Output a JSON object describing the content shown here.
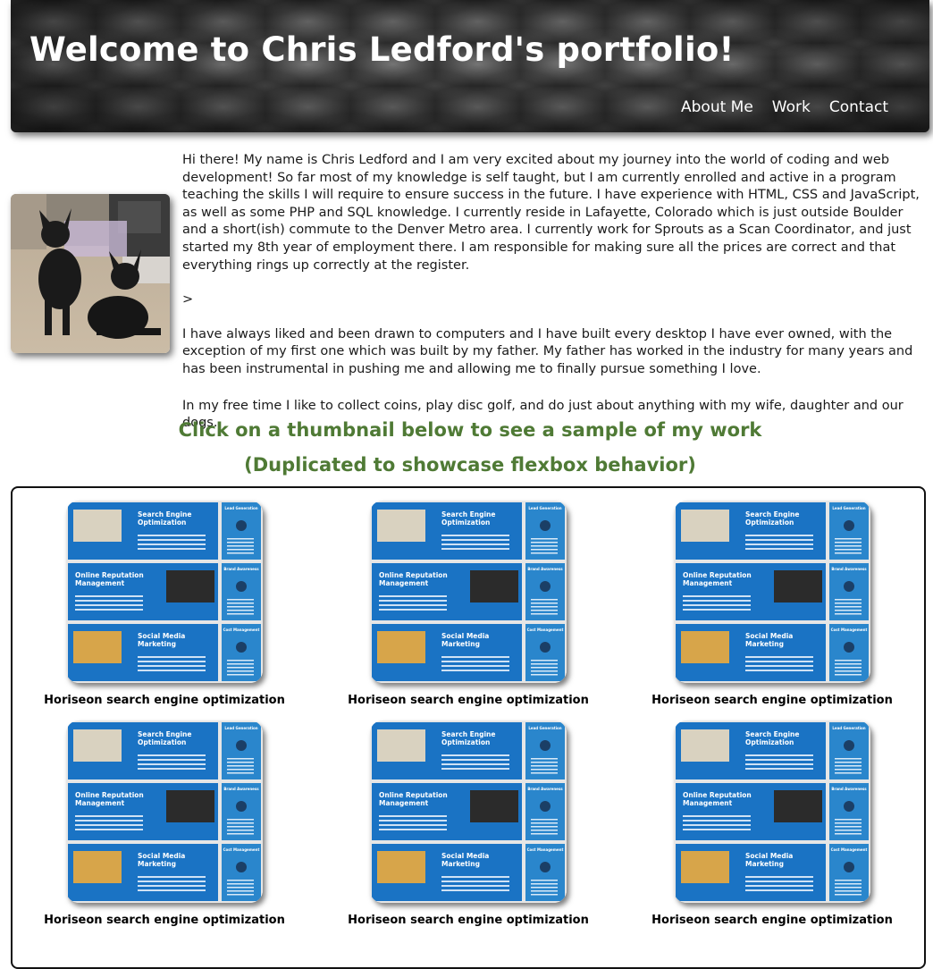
{
  "header": {
    "title": "Welcome to Chris Ledford's portfolio!",
    "nav": [
      "About Me",
      "Work",
      "Contact"
    ]
  },
  "about": {
    "paragraphs": [
      "Hi there! My name is Chris Ledford and I am very excited about my journey into the world of coding and web development! So far most of my knowledge is self taught, but I am currently enrolled and active in a program teaching the skills I will require to ensure success in the future. I have experience with HTML, CSS and JavaScript, as well as some PHP and SQL knowledge. I currently reside in Lafayette, Colorado which is just outside Boulder and a short(ish) commute to the Denver Metro area. I currently work for Sprouts as a Scan Coordinator, and just started my 8th year of employment there. I am responsible for making sure all the prices are correct and that everything rings up correctly at the register.",
      ">",
      "I have always liked and been drawn to computers and I have built every desktop I have ever owned, with the exception of my first one which was built by my father. My father has worked in the industry for many years and has been instrumental in pushing me and allowing me to finally pursue something I love.",
      "In my free time I like to collect coins, play disc golf, and do just about anything with my wife, daughter and our dogs."
    ]
  },
  "work": {
    "heading_line1": "Click on a thumbnail below to see a sample of my work",
    "heading_line2": "(Duplicated to showcase flexbox behavior)",
    "items": [
      {
        "caption": "Horiseon search engine optimization"
      },
      {
        "caption": "Horiseon search engine optimization"
      },
      {
        "caption": "Horiseon search engine optimization"
      },
      {
        "caption": "Horiseon search engine optimization"
      },
      {
        "caption": "Horiseon search engine optimization"
      },
      {
        "caption": "Horiseon search engine optimization"
      }
    ]
  },
  "thumbnail_text": {
    "seo_title": "Search Engine Optimization",
    "orm_title": "Online Reputation Management",
    "smm_title": "Social Media Marketing",
    "side_1": "Lead Generation",
    "side_2": "Brand Awareness",
    "side_3": "Cost Management"
  },
  "colors": {
    "heading_green": "#4f7a35",
    "thumb_blue": "#1a73c4",
    "thumb_side": "#2a86cc"
  }
}
